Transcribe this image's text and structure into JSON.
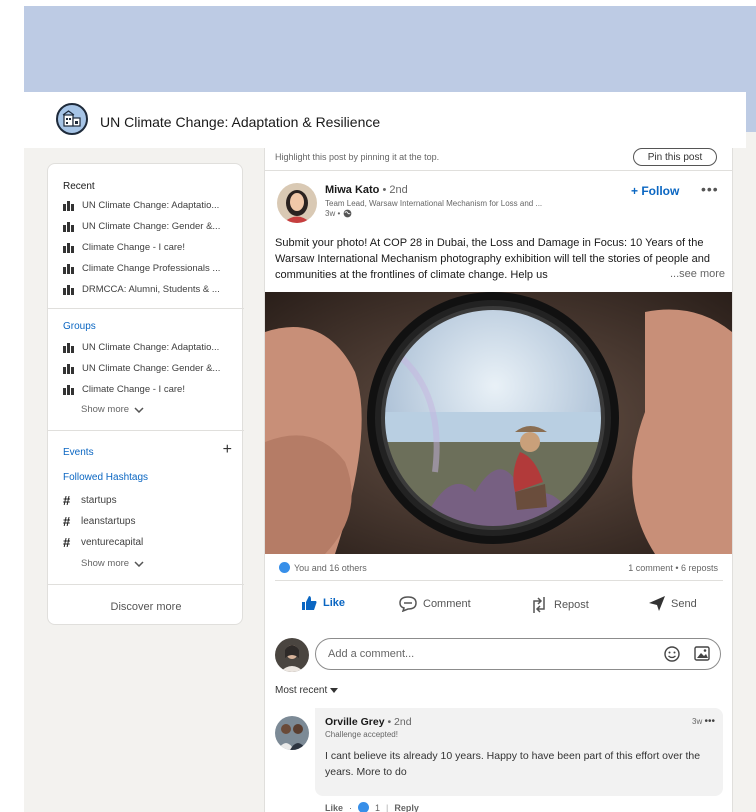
{
  "header": {
    "title": "UN Climate Change: Adaptation & Resilience"
  },
  "sidebar": {
    "recent_heading": "Recent",
    "recent": [
      "UN Climate Change: Adaptatio...",
      "UN Climate Change: Gender &...",
      "Climate Change - I care!",
      "Climate Change Professionals ...",
      "DRMCCA: Alumni, Students & ..."
    ],
    "groups_heading": "Groups",
    "groups": [
      "UN Climate Change: Adaptatio...",
      "UN Climate Change: Gender &...",
      "Climate Change - I care!"
    ],
    "show_more": "Show more",
    "events": "Events",
    "hashtags_heading": "Followed Hashtags",
    "hashtags": [
      "startups",
      "leanstartups",
      "venturecapital"
    ],
    "discover": "Discover more"
  },
  "post": {
    "pin_hint": "Highlight this post by pinning it at the top.",
    "pin_button": "Pin this post",
    "author": "Miwa Kato",
    "degree": " • 2nd",
    "subtitle": "Team Lead, Warsaw International Mechanism for Loss and ...",
    "time": "3w •",
    "follow": "+ Follow",
    "more": "•••",
    "text": "Submit your photo! At COP 28 in Dubai, the Loss and Damage in Focus: 10 Years of the Warsaw International Mechanism photography exhibition will tell the stories of people and communities at the frontlines of climate change. Help us",
    "see_more": "...see more",
    "reactions": "You and 16 others",
    "counts": "1 comment • 6 reposts",
    "actions": {
      "like": "Like",
      "comment": "Comment",
      "repost": "Repost",
      "send": "Send"
    },
    "comment_placeholder": "Add a comment...",
    "sort": "Most recent"
  },
  "comment": {
    "author": "Orville Grey",
    "degree": " • 2nd",
    "subtitle": "Challenge accepted!",
    "time": "3w",
    "more": "•••",
    "text": "I cant believe its already 10 years. Happy to have been part of this effort over the years. More to do",
    "like": "Like",
    "like_count": "1",
    "reply": "Reply"
  },
  "colors": {
    "accent": "#0a66c2",
    "band": "#bdcbe4",
    "page": "#f3f2ef"
  }
}
